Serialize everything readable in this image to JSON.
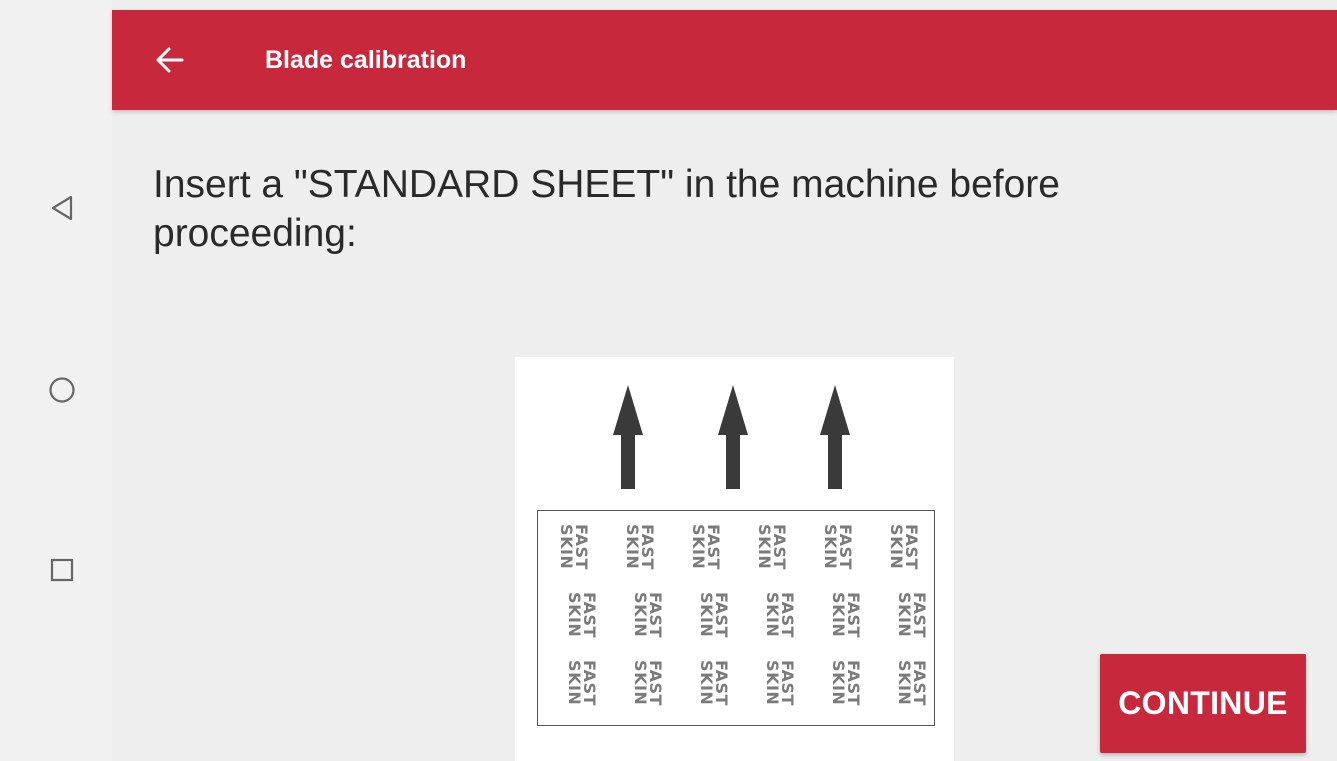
{
  "navbar": {
    "icons": [
      "back-triangle-icon",
      "home-circle-icon",
      "recents-square-icon"
    ]
  },
  "appbar": {
    "title": "Blade calibration",
    "back_icon": "arrow-left-icon",
    "color": "#c7283b"
  },
  "instruction": {
    "text": "Insert a \"STANDARD SHEET\" in the machine before proceeding:"
  },
  "illustration": {
    "arrow_icon": "arrow-up-icon",
    "arrow_count": 3,
    "sheet_rows": 3,
    "sheet_cols": 6,
    "logo_line1": "FAST",
    "logo_line2": "SKIN"
  },
  "continue_button": {
    "label": "CONTINUE",
    "color": "#c7283b"
  }
}
